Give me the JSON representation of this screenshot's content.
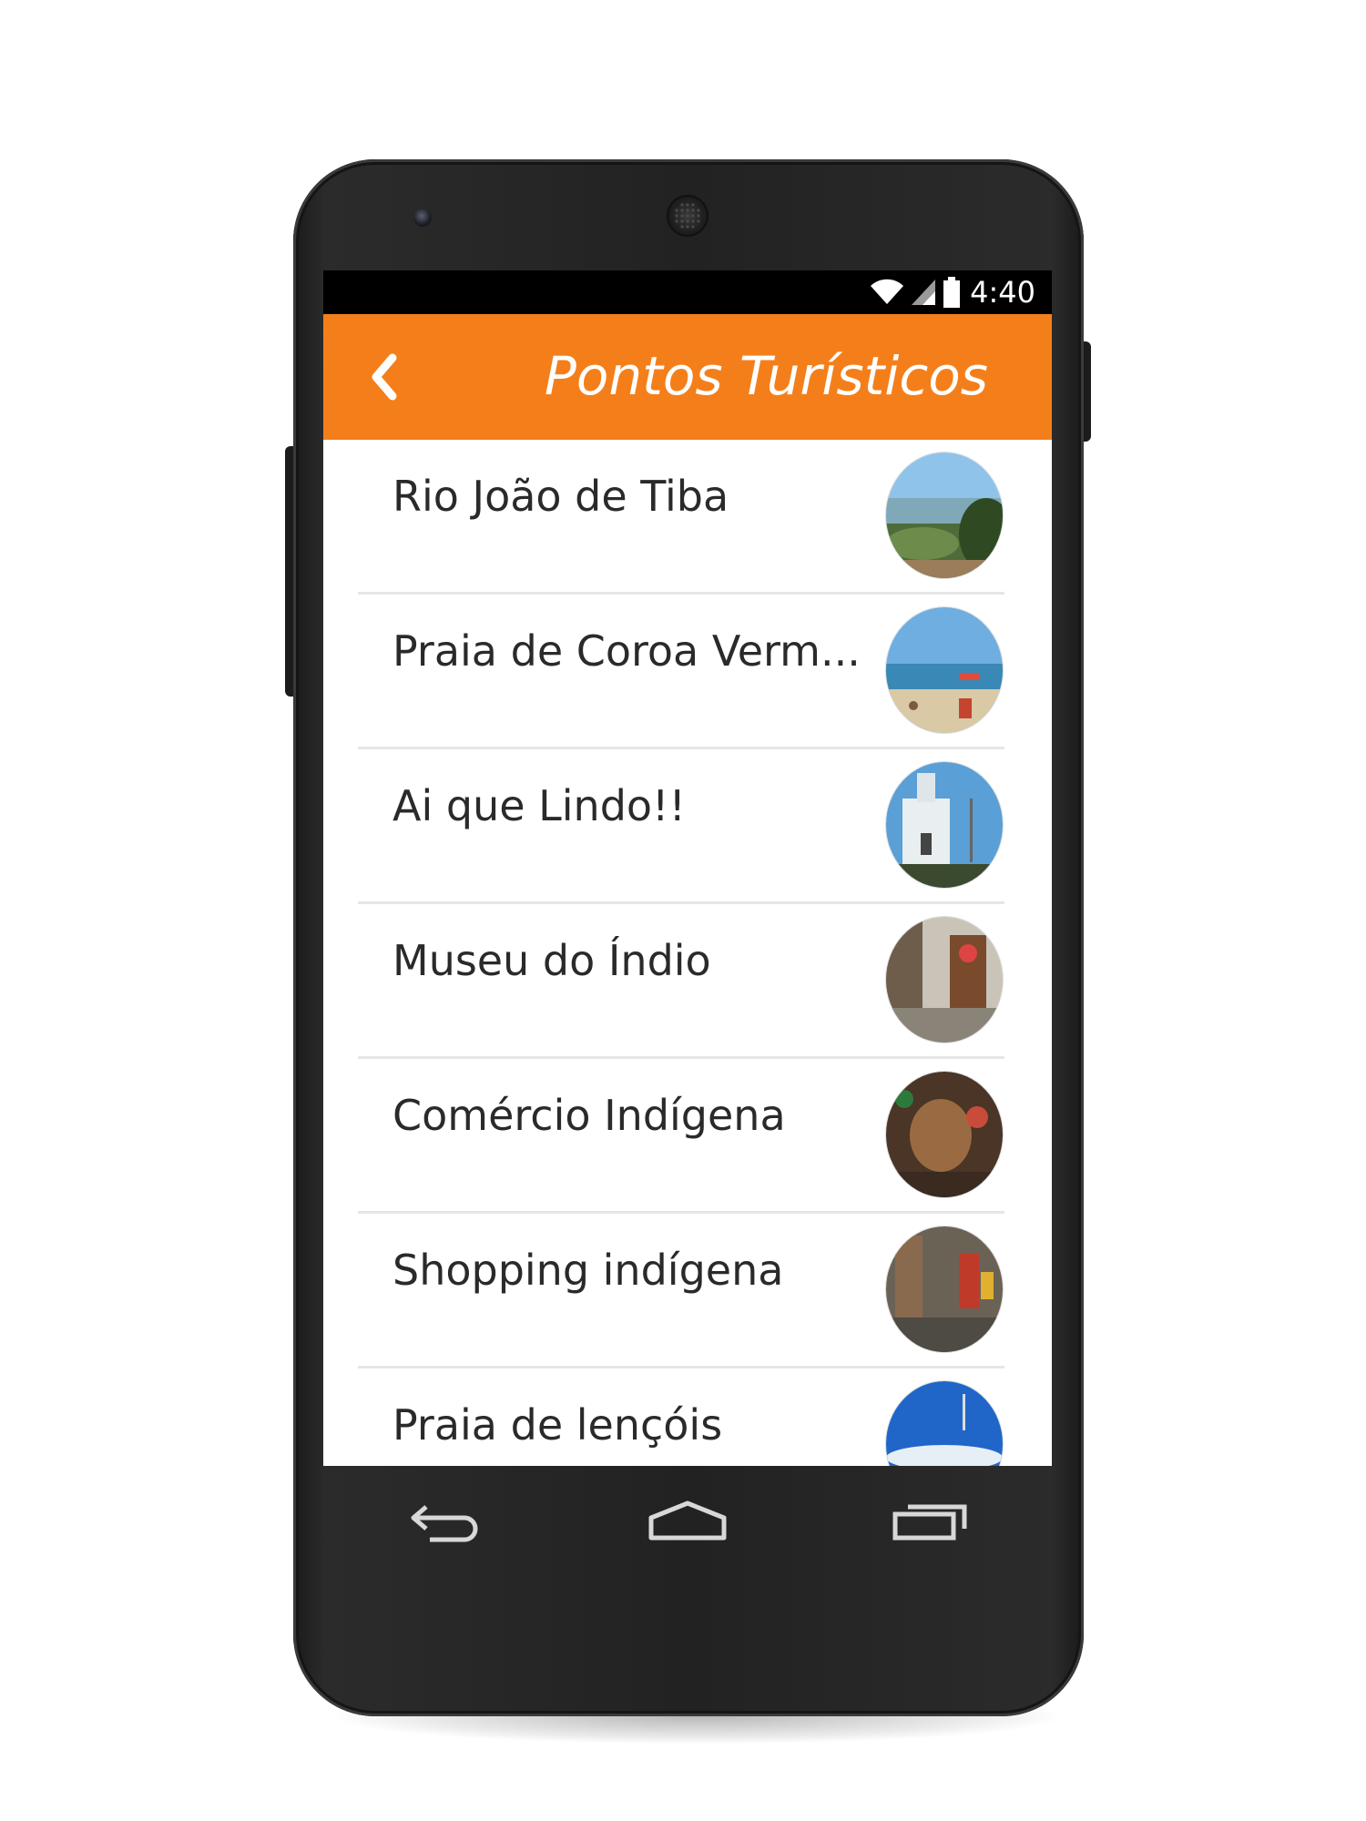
{
  "status_bar": {
    "time": "4:40",
    "icons": [
      "wifi-icon",
      "cell-signal-icon",
      "battery-icon"
    ]
  },
  "app_bar": {
    "title": "Pontos Turísticos",
    "back_icon": "chevron-left-icon",
    "color": "#f47f1a"
  },
  "places": [
    {
      "label": "Rio João de Tiba"
    },
    {
      "label": "Praia de Coroa Verm..."
    },
    {
      "label": "Ai que Lindo!!"
    },
    {
      "label": "Museu do Índio"
    },
    {
      "label": "Comércio Indígena"
    },
    {
      "label": "Shopping indígena"
    },
    {
      "label": "Praia de lençóis"
    }
  ],
  "nav_bar": {
    "icons": [
      "back-icon",
      "home-icon",
      "recents-icon"
    ]
  }
}
